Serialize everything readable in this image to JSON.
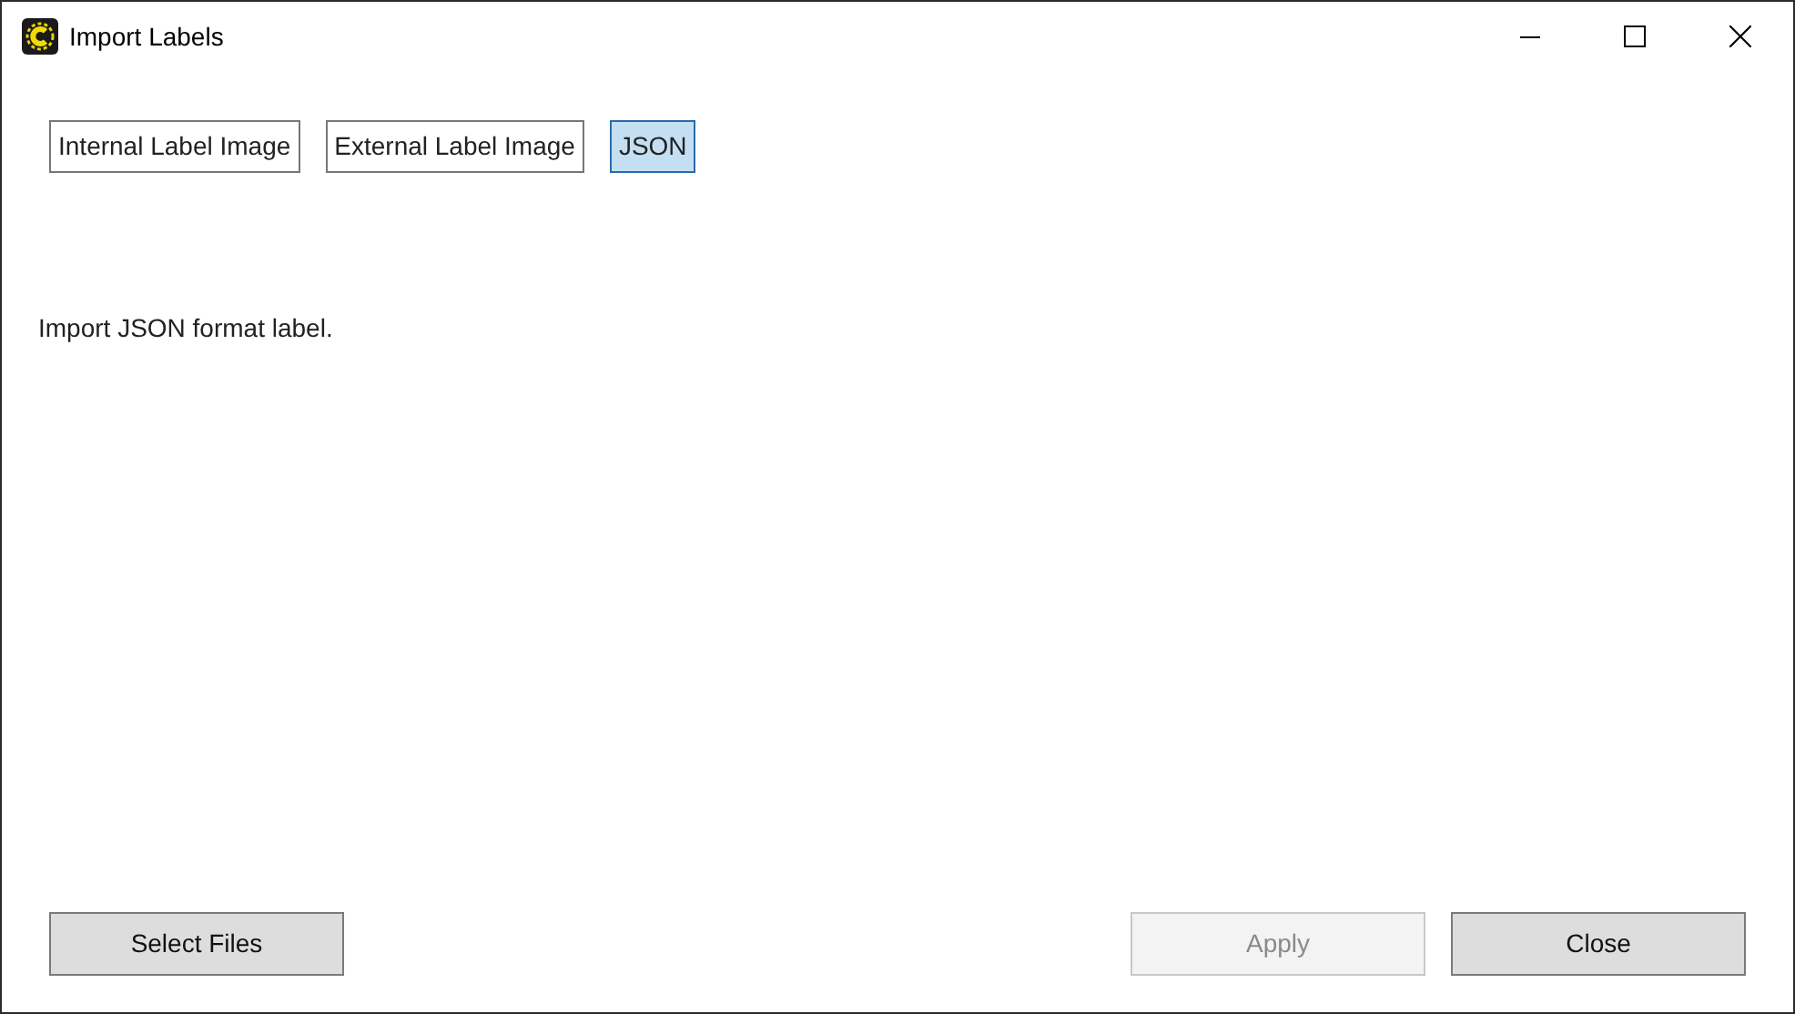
{
  "window": {
    "title": "Import Labels"
  },
  "tabs": [
    {
      "label": "Internal Label Image",
      "selected": false
    },
    {
      "label": "External Label Image",
      "selected": false
    },
    {
      "label": "JSON",
      "selected": true
    }
  ],
  "description": "Import JSON format label.",
  "left_buttons": [
    {
      "label": "Select Files",
      "disabled": false
    }
  ],
  "right_buttons": [
    {
      "label": "Apply",
      "disabled": true
    },
    {
      "label": "Close",
      "disabled": false
    }
  ]
}
